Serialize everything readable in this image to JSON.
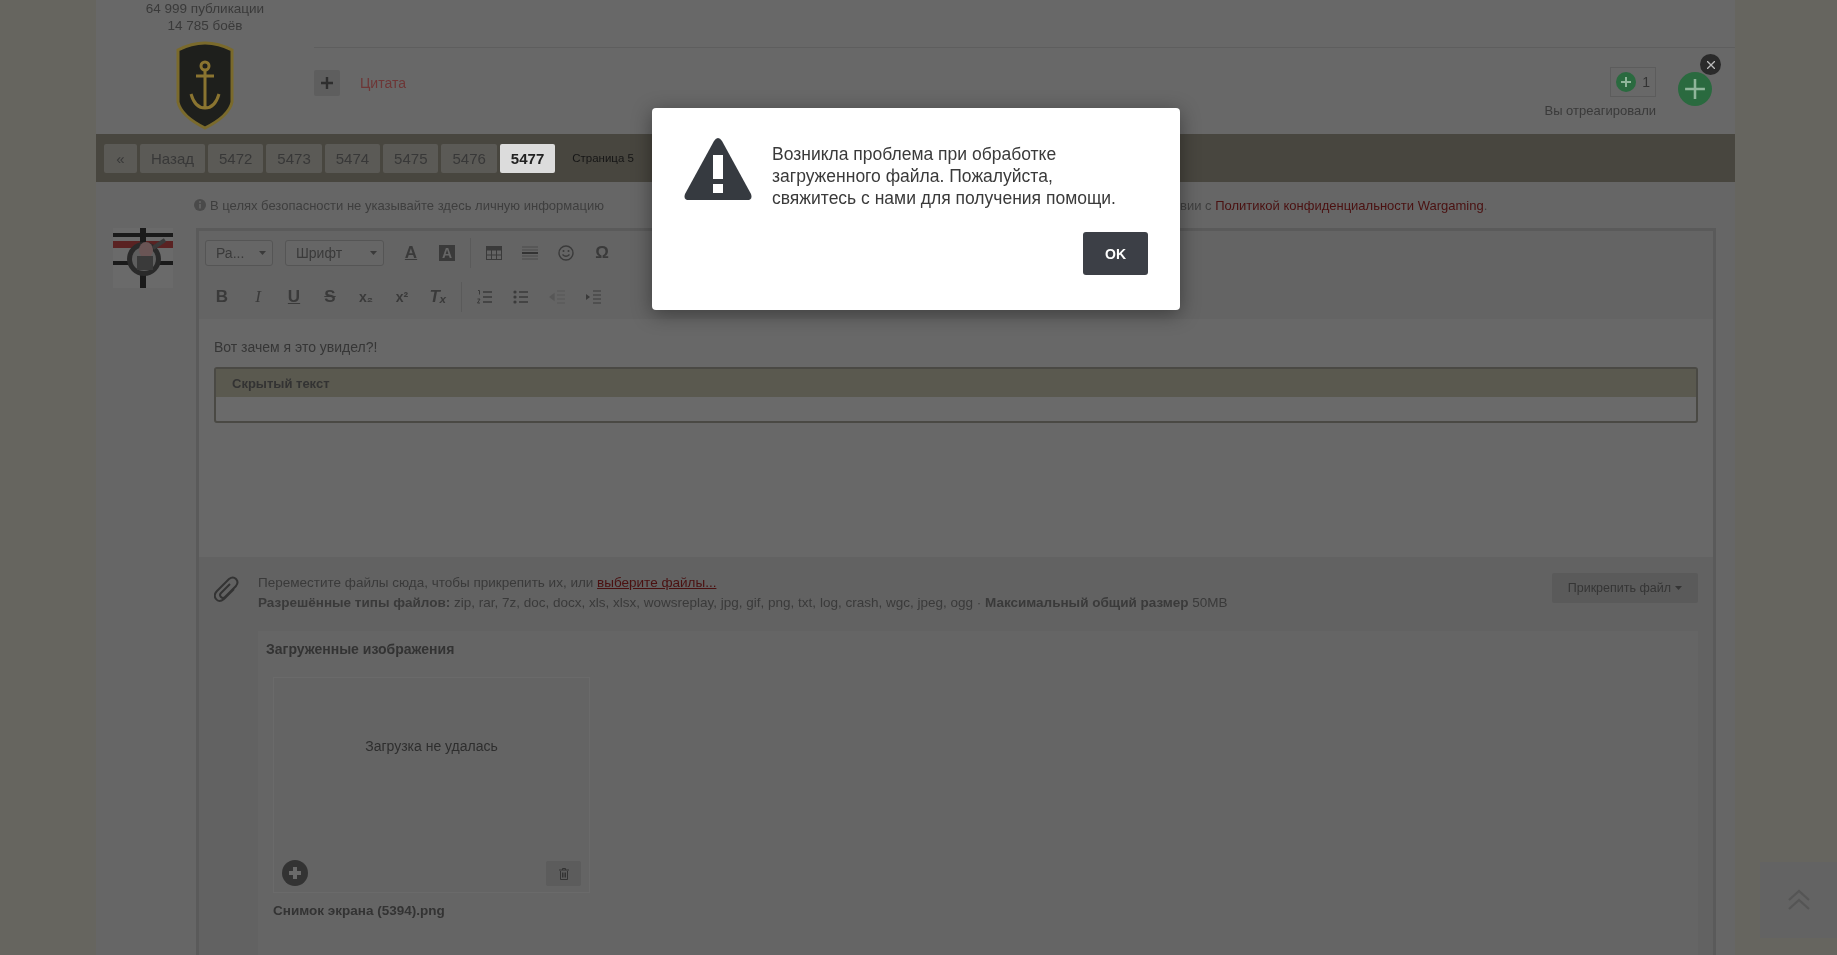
{
  "user": {
    "posts": "64 999 публикации",
    "battles": "14 785 боёв"
  },
  "post_actions": {
    "quote": "Цитата"
  },
  "reactions": {
    "count": "1",
    "label": "Вы отреагировали"
  },
  "pagination": {
    "first": "«",
    "back": "Назад",
    "pages": [
      {
        "label": "5472",
        "selected": false
      },
      {
        "label": "5473",
        "selected": false
      },
      {
        "label": "5474",
        "selected": false
      },
      {
        "label": "5475",
        "selected": false
      },
      {
        "label": "5476",
        "selected": false
      },
      {
        "label": "5477",
        "selected": true
      }
    ],
    "page_info": "Страница 5"
  },
  "notice": {
    "text": "В целях безопасности не указывайте здесь личную информацию",
    "text_end": "вии с ",
    "link": "Политикой конфиденциальности Wargaming",
    "end": "."
  },
  "editor": {
    "format_dropdown": "Ра...",
    "font_dropdown": "Шрифт",
    "toolbar_row1": [
      {
        "kind": "text-color",
        "label": "A"
      },
      {
        "kind": "background-color",
        "label": "A"
      },
      {
        "kind": "table"
      },
      {
        "kind": "horizontal-line"
      },
      {
        "kind": "emoji"
      },
      {
        "kind": "special-char",
        "label": "Ω"
      }
    ],
    "format_buttons": [
      {
        "kind": "bold",
        "label": "B"
      },
      {
        "kind": "italic",
        "label": "I"
      },
      {
        "kind": "underline",
        "label": "U"
      },
      {
        "kind": "strike",
        "label": "S"
      },
      {
        "kind": "subscript",
        "label": "x₂"
      },
      {
        "kind": "superscript",
        "label": "x²"
      },
      {
        "kind": "clear",
        "label": "Tₓ"
      }
    ],
    "list_buttons": [
      {
        "kind": "ordered-list",
        "disabled": false
      },
      {
        "kind": "bullet-list",
        "disabled": false
      },
      {
        "kind": "outdent",
        "disabled": true
      },
      {
        "kind": "indent",
        "disabled": false
      }
    ],
    "content": "Вот зачем я это увидел?!",
    "spoiler_title": "Скрытый текст"
  },
  "attachments": {
    "drop_text": "Переместите файлы сюда, чтобы прикрепить их, или ",
    "choose_link": "выберите файлы...",
    "allowed": "**Разрешённые типы файлов:** zip, rar, 7z, doc, docx, xls, xlsx, wowsreplay, jpg, gif, png, txt, log, crash, wgc, jpeg, ogg · **Максимальный общий размер** 50MB",
    "attach_button": "Прикрепить файл",
    "uploaded_title": "Загруженные изображения",
    "files": [
      {
        "status": "Загрузка не удалась",
        "name": "Снимок экрана (5394).png"
      }
    ]
  },
  "dialog": {
    "message": "Возникла проблема при обработке загруженного файла. Пожалуйста, свяжитесь с нами для получения помощи.",
    "button": "OK"
  }
}
